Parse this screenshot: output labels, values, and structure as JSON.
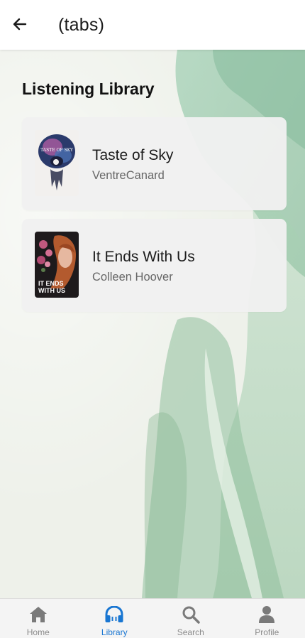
{
  "header": {
    "title": "(tabs)",
    "back_icon": "arrow-left-icon"
  },
  "library": {
    "heading": "Listening Library",
    "books": [
      {
        "title": "Taste of Sky",
        "author": "VentreCanard",
        "cover_text": "TASTE OF SKY"
      },
      {
        "title": "It Ends With Us",
        "author": "Colleen Hoover",
        "cover_text_line1": "IT ENDS",
        "cover_text_line2": "WITH US"
      }
    ]
  },
  "nav": {
    "items": [
      {
        "label": "Home",
        "icon": "home-icon"
      },
      {
        "label": "Library",
        "icon": "headphones-icon"
      },
      {
        "label": "Search",
        "icon": "search-icon"
      },
      {
        "label": "Profile",
        "icon": "person-icon"
      }
    ],
    "active": "Library"
  },
  "colors": {
    "accent": "#1976d2",
    "inactive": "#8a8a8a",
    "watercolor_green": "#8fc1a4"
  }
}
